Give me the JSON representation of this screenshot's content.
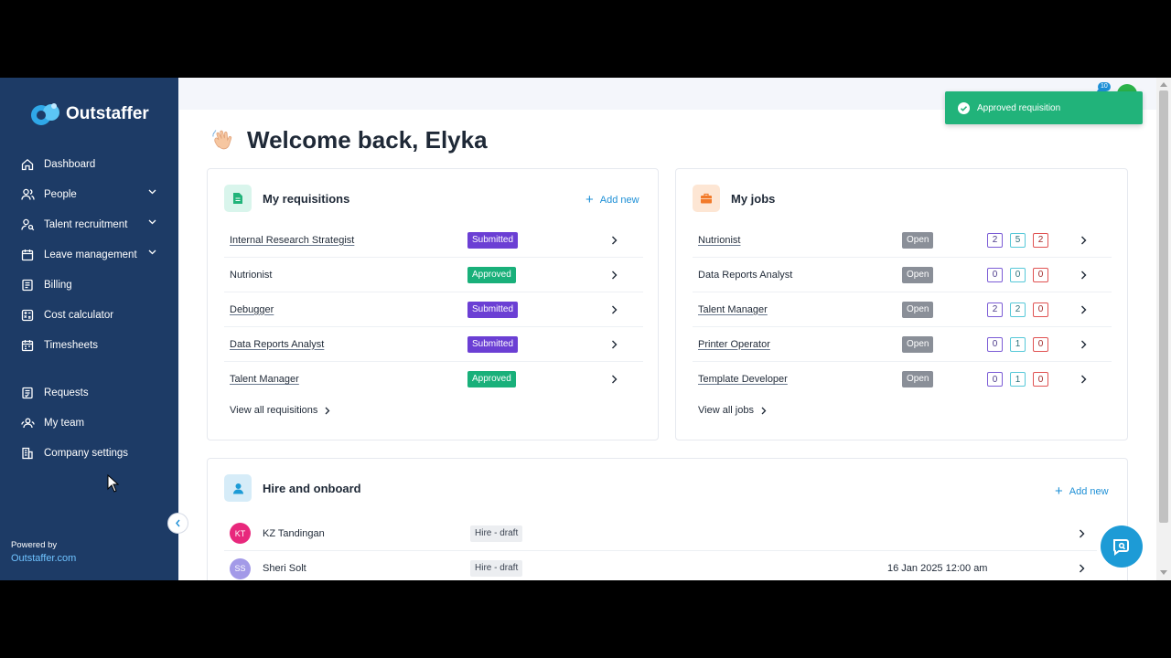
{
  "brand": {
    "name": "Outstaffer"
  },
  "sidebar": {
    "items": [
      {
        "label": "Dashboard",
        "icon": "home-icon",
        "expandable": false
      },
      {
        "label": "People",
        "icon": "people-icon",
        "expandable": true
      },
      {
        "label": "Talent recruitment",
        "icon": "user-search-icon",
        "expandable": true
      },
      {
        "label": "Leave management",
        "icon": "calendar-icon",
        "expandable": true
      },
      {
        "label": "Billing",
        "icon": "billing-icon",
        "expandable": false
      },
      {
        "label": "Cost calculator",
        "icon": "calculator-icon",
        "expandable": false
      },
      {
        "label": "Timesheets",
        "icon": "timesheet-icon",
        "expandable": false
      },
      {
        "label": "Requests",
        "icon": "requests-icon",
        "expandable": false
      },
      {
        "label": "My team",
        "icon": "team-icon",
        "expandable": false
      },
      {
        "label": "Company settings",
        "icon": "building-icon",
        "expandable": false
      }
    ],
    "powered_by": "Powered by",
    "powered_link": "Outstaffer.com"
  },
  "header": {
    "notifications_count": "10"
  },
  "welcome": {
    "title": "Welcome back, Elyka"
  },
  "requisitions": {
    "title": "My requisitions",
    "add_new": "Add new",
    "rows": [
      {
        "name": "Internal Research Strategist",
        "status": "Submitted",
        "link": true
      },
      {
        "name": "Nutrionist",
        "status": "Approved",
        "link": false
      },
      {
        "name": "Debugger",
        "status": "Submitted",
        "link": true
      },
      {
        "name": "Data Reports Analyst",
        "status": "Submitted",
        "link": true
      },
      {
        "name": "Talent Manager",
        "status": "Approved",
        "link": true
      }
    ],
    "view_all": "View all requisitions"
  },
  "jobs": {
    "title": "My jobs",
    "rows": [
      {
        "name": "Nutrionist",
        "status": "Open",
        "counts": [
          "2",
          "5",
          "2"
        ],
        "link": true
      },
      {
        "name": "Data Reports Analyst",
        "status": "Open",
        "counts": [
          "0",
          "0",
          "0"
        ],
        "link": false
      },
      {
        "name": "Talent Manager",
        "status": "Open",
        "counts": [
          "2",
          "2",
          "0"
        ],
        "link": true
      },
      {
        "name": "Printer Operator",
        "status": "Open",
        "counts": [
          "0",
          "1",
          "0"
        ],
        "link": true
      },
      {
        "name": "Template Developer",
        "status": "Open",
        "counts": [
          "0",
          "1",
          "0"
        ],
        "link": true
      }
    ],
    "view_all": "View all jobs"
  },
  "hire": {
    "title": "Hire and onboard",
    "add_new": "Add new",
    "rows": [
      {
        "initials": "KT",
        "name": "KZ Tandingan",
        "status": "Hire - draft",
        "date": "",
        "color": "#e8287c"
      },
      {
        "initials": "SS",
        "name": "Sheri Solt",
        "status": "Hire - draft",
        "date": "16 Jan 2025 12:00 am",
        "color": "#a39ae8"
      }
    ]
  },
  "toast": {
    "message": "Approved requisition"
  },
  "colors": {
    "sidebar": "#1d3b66",
    "accent": "#1d8fd6",
    "submitted": "#6b3fd4",
    "approved": "#19b07a",
    "open": "#8a8f98"
  }
}
